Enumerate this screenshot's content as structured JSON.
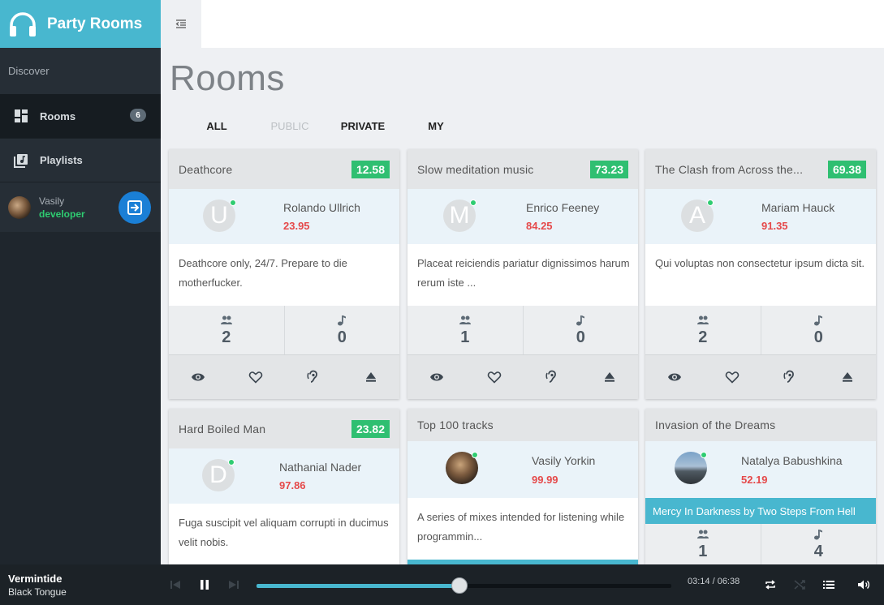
{
  "app": {
    "brand": "Party Rooms",
    "discover": "Discover"
  },
  "sidebar": {
    "items": [
      {
        "label": "Rooms",
        "badge": "6"
      },
      {
        "label": "Playlists"
      }
    ],
    "user": {
      "name": "Vasily",
      "role": "developer"
    }
  },
  "page": {
    "title": "Rooms"
  },
  "tabs": [
    "ALL",
    "PUBLIC",
    "PRIVATE",
    "MY"
  ],
  "rooms": [
    {
      "title": "Deathcore",
      "score": "12.58",
      "owner_initial": "U",
      "owner": "Rolando Ullrich",
      "owner_score": "23.95",
      "description": "Deathcore only, 24/7. Prepare to die motherfucker.",
      "listeners": "2",
      "tracks": "0"
    },
    {
      "title": "Slow meditation music",
      "score": "73.23",
      "owner_initial": "M",
      "owner": "Enrico Feeney",
      "owner_score": "84.25",
      "description": "Placeat reiciendis pariatur dignissimos harum rerum iste ...",
      "listeners": "1",
      "tracks": "0"
    },
    {
      "title": "The Clash from Across the...",
      "score": "69.38",
      "owner_initial": "A",
      "owner": "Mariam Hauck",
      "owner_score": "91.35",
      "description": "Qui voluptas non consectetur ipsum dicta sit.",
      "listeners": "2",
      "tracks": "0"
    },
    {
      "title": "Hard Boiled Man",
      "score": "23.82",
      "owner_initial": "D",
      "owner": "Nathanial Nader",
      "owner_score": "97.86",
      "description": "Fuga suscipit vel aliquam corrupti in ducimus velit nobis."
    },
    {
      "title": "Top 100 tracks",
      "owner": "Vasily Yorkin",
      "owner_score": "99.99",
      "description": "A series of mixes intended for listening while programmin..."
    },
    {
      "title": "Invasion of the Dreams",
      "owner": "Natalya Babushkina",
      "owner_score": "52.19",
      "now_playing": "Mercy In Darkness by Two Steps From Hell",
      "listeners": "1",
      "tracks": "4"
    }
  ],
  "player": {
    "track": "Vermintide",
    "artist": "Black Tongue",
    "time": "03:14 / 06:38",
    "progress": 0.49
  },
  "colors": {
    "accent": "#48b7cf",
    "score_green": "#2fbf71",
    "owner_score_red": "#e5494a",
    "online": "#2ecc71"
  }
}
